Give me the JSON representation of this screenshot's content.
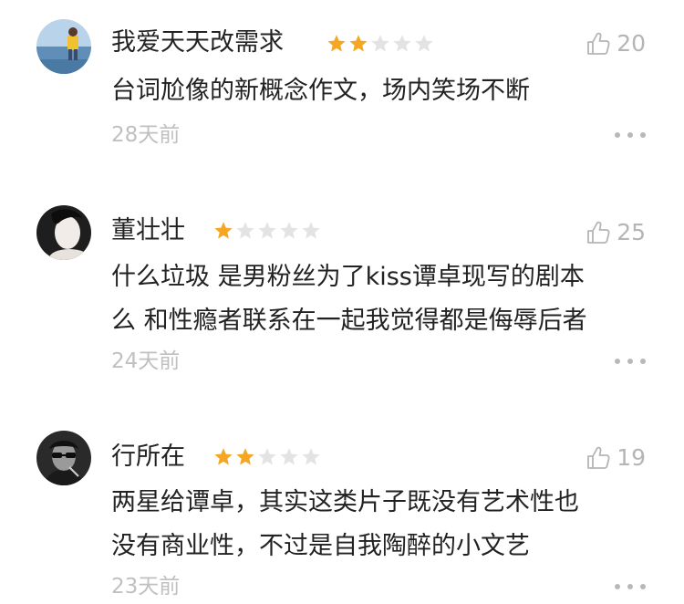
{
  "reviews": [
    {
      "username": "我爱天天改需求",
      "rating": 2,
      "max_rating": 5,
      "likes": "20",
      "content_lines": [
        "台词尬像的新概念作文，场内笑场不断"
      ],
      "date": "28天前",
      "avatar_icon": "beach-person-avatar"
    },
    {
      "username": "董壮壮",
      "rating": 1,
      "max_rating": 5,
      "likes": "25",
      "content_lines": [
        "什么垃圾 是男粉丝为了kiss谭卓现写的剧本",
        "么 和性瘾者联系在一起我觉得都是侮辱后者"
      ],
      "date": "24天前",
      "avatar_icon": "dark-portrait-avatar"
    },
    {
      "username": "行所在",
      "rating": 2,
      "max_rating": 5,
      "likes": "19",
      "content_lines": [
        "两星给谭卓，其实这类片子既没有艺术性也",
        "没有商业性，不过是自我陶醉的小文艺"
      ],
      "date": "23天前",
      "avatar_icon": "sunglasses-portrait-avatar"
    }
  ],
  "colors": {
    "star_filled": "#F5A623",
    "star_empty": "#E3E3E3",
    "muted": "#B5B5B5"
  }
}
